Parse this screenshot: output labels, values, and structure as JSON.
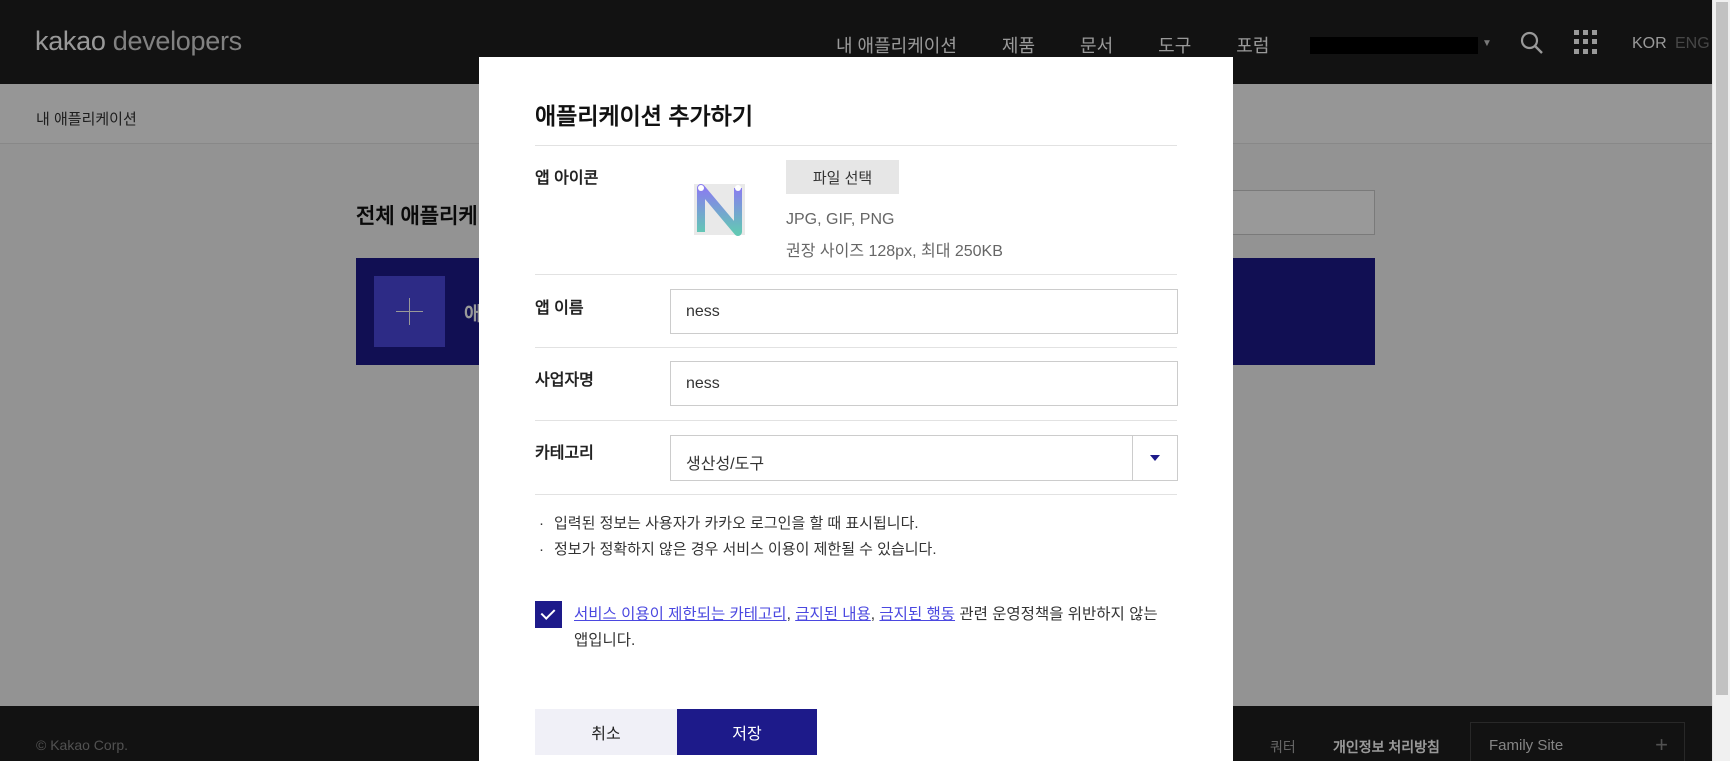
{
  "header": {
    "logo_bold": "kakao",
    "logo_light": " developers",
    "nav": [
      "내 애플리케이션",
      "제품",
      "문서",
      "도구",
      "포럼"
    ],
    "lang_kor": "KOR",
    "lang_eng": "ENG"
  },
  "subnav": {
    "label": "내 애플리케이션"
  },
  "page": {
    "title": "전체 애플리케이션",
    "add_banner_text": "애"
  },
  "footer": {
    "copyright": "© Kakao Corp.",
    "link1": "쿼터",
    "link2": "개인정보 처리방침",
    "family_site": "Family Site",
    "family_plus": "+"
  },
  "modal": {
    "title": "애플리케이션 추가하기",
    "icon_label": "앱 아이콘",
    "file_button": "파일 선택",
    "hint_formats": "JPG, GIF, PNG",
    "hint_size": "권장 사이즈 128px, 최대 250KB",
    "app_name_label": "앱 이름",
    "app_name_value": "ness",
    "company_label": "사업자명",
    "company_value": "ness",
    "category_label": "카테고리",
    "category_value": "생산성/도구",
    "note1": "입력된 정보는 사용자가 카카오 로그인을 할 때 표시됩니다.",
    "note2": "정보가 정확하지 않은 경우 서비스 이용이 제한될 수 있습니다.",
    "agree_link1": "서비스 이용이 제한되는 카테고리",
    "agree_link2": "금지된 내용",
    "agree_link3": "금지된 행동",
    "agree_text": " 관련 운영정책을 위반하지 않는 앱입니다.",
    "agree_checked": true,
    "cancel_button": "취소",
    "save_button": "저장"
  },
  "colors": {
    "brand_navy": "#1d1a8a",
    "accent_link": "#4b48e0"
  }
}
